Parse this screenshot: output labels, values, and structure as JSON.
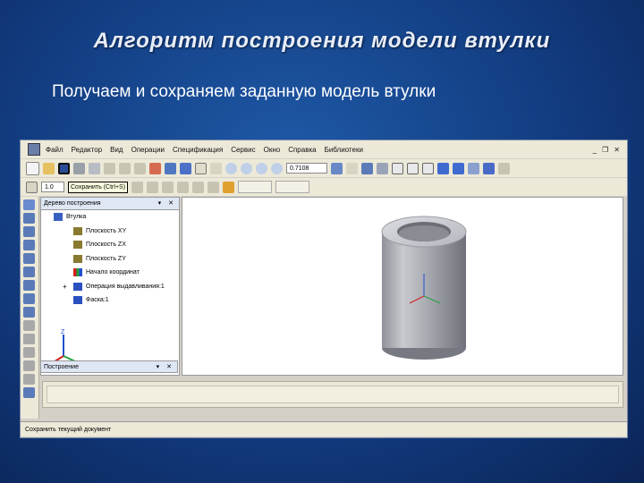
{
  "slide": {
    "title": "Алгоритм построения модели втулки",
    "subtitle": "Получаем и сохраняем заданную модель втулки"
  },
  "app": {
    "menu": [
      "Файл",
      "Редактор",
      "Вид",
      "Операции",
      "Спецификация",
      "Сервис",
      "Окно",
      "Справка",
      "Библиотеки"
    ],
    "zoom_value": "0.7108",
    "step_value": "1.0",
    "tooltip": "Сохранить (Ctrl+S)",
    "tree": {
      "title": "Дерево построения",
      "root": "Втулка",
      "items": [
        "Плоскость XY",
        "Плоскость ZX",
        "Плоскость ZY",
        "Начало координат",
        "Операция выдавливания:1",
        "Фаска:1"
      ],
      "footer_tab": "Построение"
    },
    "status": "Сохранить текущий документ",
    "axis_labels": {
      "x": "X",
      "y": "Y",
      "z": "Z"
    }
  },
  "colors": {
    "slide_bg": "#123c80",
    "cylinder_light": "#c9cacf",
    "cylinder_dark": "#7d7f88",
    "axis_x": "#d02020",
    "axis_y": "#20a040",
    "axis_z": "#2050d0"
  }
}
